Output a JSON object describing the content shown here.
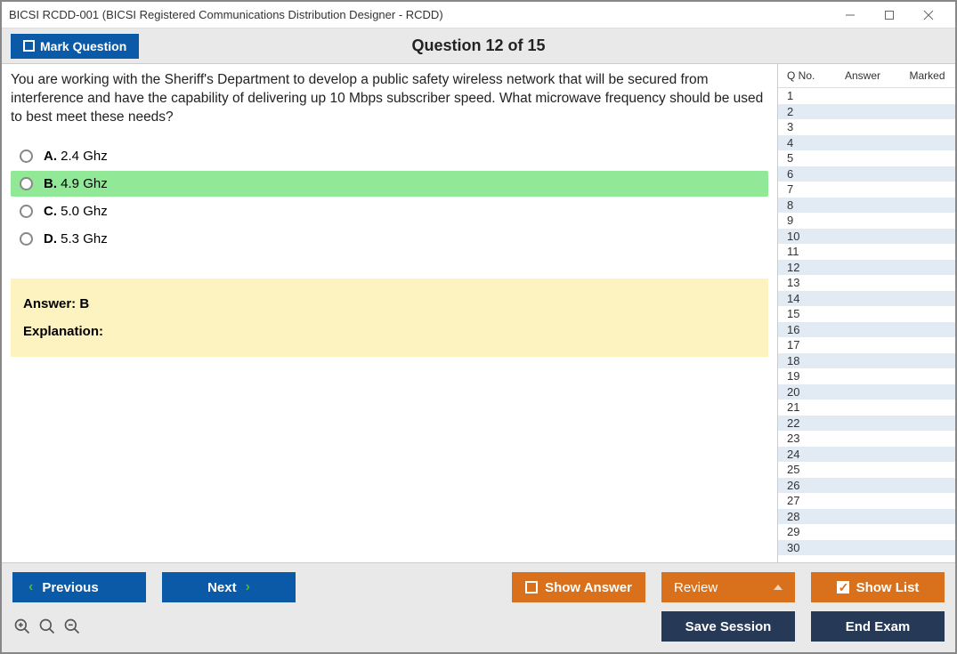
{
  "titlebar": {
    "title": "BICSI RCDD-001 (BICSI Registered Communications Distribution Designer - RCDD)"
  },
  "header": {
    "mark_label": "Mark Question",
    "counter": "Question 12 of 15"
  },
  "question": {
    "text": "You are working with the Sheriff's Department to develop a public safety wireless network that will be secured from interference and have the capability of delivering up 10 Mbps subscriber speed. What microwave frequency should be used to best meet these needs?",
    "options": [
      {
        "letter": "A.",
        "text": "2.4 Ghz",
        "highlighted": false
      },
      {
        "letter": "B.",
        "text": "4.9 Ghz",
        "highlighted": true
      },
      {
        "letter": "C.",
        "text": "5.0 Ghz",
        "highlighted": false
      },
      {
        "letter": "D.",
        "text": "5.3 Ghz",
        "highlighted": false
      }
    ],
    "answer_label": "Answer: B",
    "explanation_label": "Explanation:"
  },
  "sidepanel": {
    "col_qno": "Q No.",
    "col_answer": "Answer",
    "col_marked": "Marked",
    "rows": [
      1,
      2,
      3,
      4,
      5,
      6,
      7,
      8,
      9,
      10,
      11,
      12,
      13,
      14,
      15,
      16,
      17,
      18,
      19,
      20,
      21,
      22,
      23,
      24,
      25,
      26,
      27,
      28,
      29,
      30
    ]
  },
  "buttons": {
    "previous": "Previous",
    "next": "Next",
    "show_answer": "Show Answer",
    "review": "Review",
    "show_list": "Show List",
    "save_session": "Save Session",
    "end_exam": "End Exam"
  }
}
